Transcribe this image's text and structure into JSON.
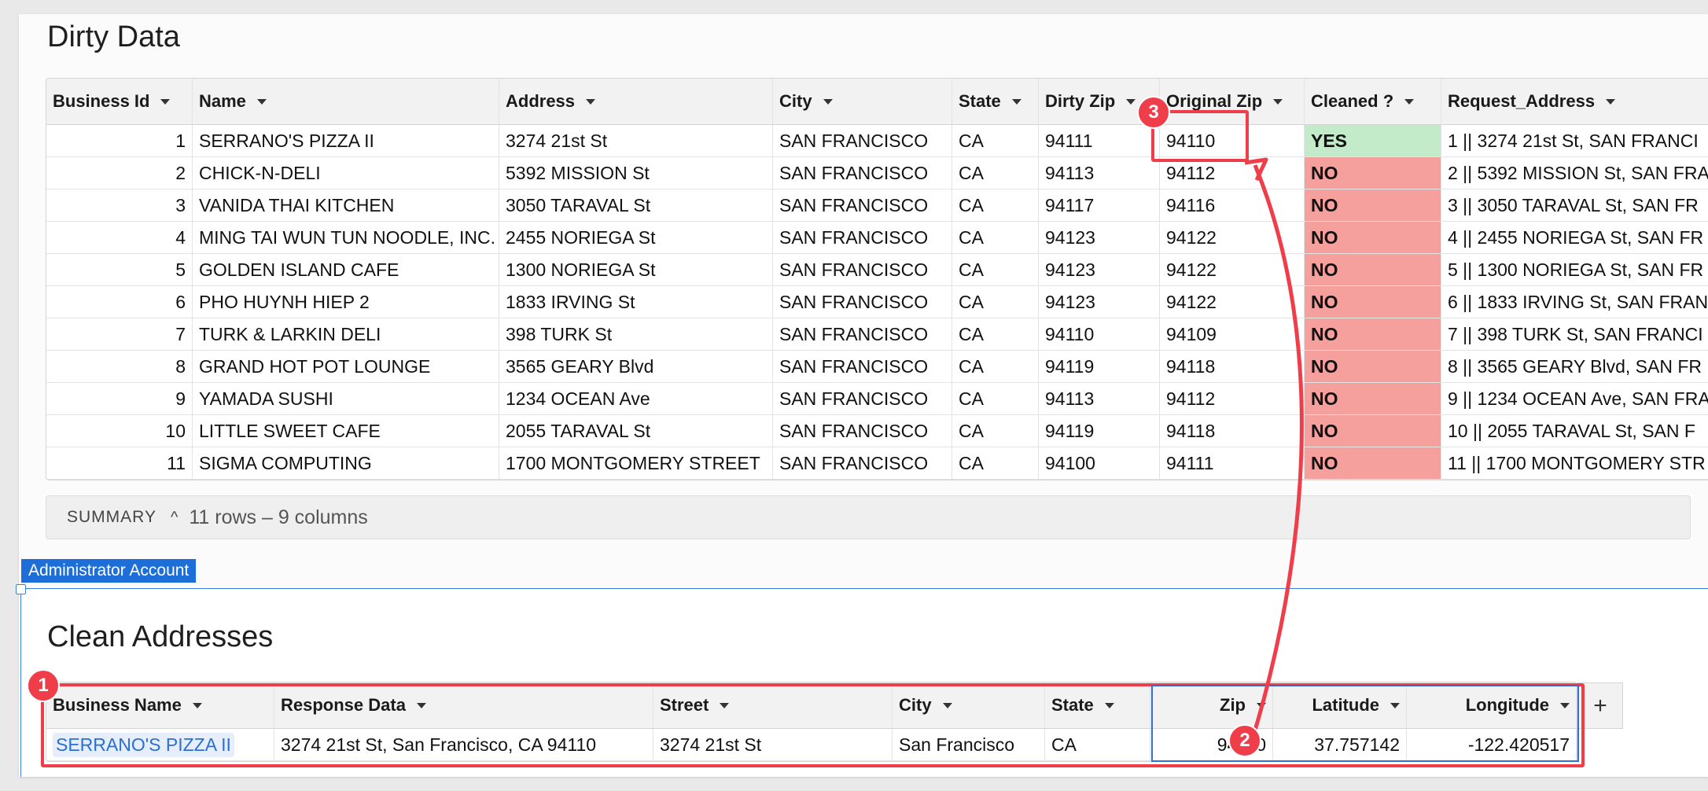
{
  "dirty": {
    "title": "Dirty Data",
    "columns": [
      "Business Id",
      "Name",
      "Address",
      "City",
      "State",
      "Dirty Zip",
      "Original Zip",
      "Cleaned ?",
      "Request_Address"
    ],
    "rows": [
      [
        "1",
        "SERRANO'S PIZZA II",
        "3274 21st St",
        "SAN FRANCISCO",
        "CA",
        "94111",
        "94110",
        "YES",
        "1 || 3274 21st St, SAN FRANCI"
      ],
      [
        "2",
        "CHICK-N-DELI",
        "5392 MISSION St",
        "SAN FRANCISCO",
        "CA",
        "94113",
        "94112",
        "NO",
        "2 || 5392 MISSION St, SAN FRA"
      ],
      [
        "3",
        "VANIDA THAI KITCHEN",
        "3050 TARAVAL St",
        "SAN FRANCISCO",
        "CA",
        "94117",
        "94116",
        "NO",
        "3 || 3050 TARAVAL St, SAN FR"
      ],
      [
        "4",
        "MING TAI WUN TUN NOODLE, INC.",
        "2455 NORIEGA St",
        "SAN FRANCISCO",
        "CA",
        "94123",
        "94122",
        "NO",
        "4 || 2455 NORIEGA St, SAN FR"
      ],
      [
        "5",
        "GOLDEN ISLAND CAFE",
        "1300 NORIEGA St",
        "SAN FRANCISCO",
        "CA",
        "94123",
        "94122",
        "NO",
        "5 || 1300 NORIEGA St, SAN FR"
      ],
      [
        "6",
        "PHO HUYNH HIEP 2",
        "1833 IRVING St",
        "SAN FRANCISCO",
        "CA",
        "94123",
        "94122",
        "NO",
        "6 || 1833 IRVING St, SAN FRAN"
      ],
      [
        "7",
        "TURK & LARKIN DELI",
        "398 TURK St",
        "SAN FRANCISCO",
        "CA",
        "94110",
        "94109",
        "NO",
        "7 || 398 TURK St, SAN FRANCI"
      ],
      [
        "8",
        "GRAND HOT POT LOUNGE",
        "3565 GEARY Blvd",
        "SAN FRANCISCO",
        "CA",
        "94119",
        "94118",
        "NO",
        "8 || 3565 GEARY Blvd, SAN FR"
      ],
      [
        "9",
        "YAMADA SUSHI",
        "1234 OCEAN Ave",
        "SAN FRANCISCO",
        "CA",
        "94113",
        "94112",
        "NO",
        "9 || 1234 OCEAN Ave, SAN FRA"
      ],
      [
        "10",
        "LITTLE SWEET CAFE",
        "2055 TARAVAL St",
        "SAN FRANCISCO",
        "CA",
        "94119",
        "94118",
        "NO",
        "10 || 2055 TARAVAL St, SAN F"
      ],
      [
        "11",
        "SIGMA COMPUTING",
        "1700 MONTGOMERY STREET",
        "SAN FRANCISCO",
        "CA",
        "94100",
        "94111",
        "NO",
        "11 || 1700 MONTGOMERY STR"
      ]
    ]
  },
  "summary": {
    "label": "SUMMARY",
    "caret": "^",
    "count": "11 rows – 9 columns"
  },
  "admin_tag": "Administrator Account",
  "clean": {
    "title": "Clean Addresses",
    "columns": [
      "Business Name",
      "Response Data",
      "Street",
      "City",
      "State",
      "Zip",
      "Latitude",
      "Longitude"
    ],
    "rows": [
      [
        "SERRANO'S PIZZA II",
        "3274 21st St, San Francisco, CA 94110",
        "3274 21st St",
        "San Francisco",
        "CA",
        "94110",
        "37.757142",
        "-122.420517"
      ]
    ],
    "add_label": "+"
  },
  "annotations": [
    "1",
    "2",
    "3"
  ],
  "colors": {
    "accent": "#ef3e4a",
    "yes": "#c3ebc9",
    "no": "#f6a09d",
    "selection": "#1e6ed9"
  }
}
